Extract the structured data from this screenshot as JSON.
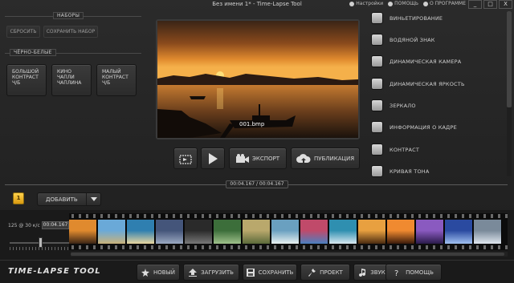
{
  "window": {
    "title": "Без имени 1* - Time-Lapse Tool",
    "links": [
      "Настройки",
      "ПОМОЩЬ",
      "О ПРОГРАММЕ"
    ],
    "buttons": [
      "_",
      "□",
      "X"
    ]
  },
  "presets_panel": {
    "section_label": "НАБОРЫ",
    "reset_label": "СБРОСИТЬ",
    "save_label": "СОХРАНИТЬ НАБОР",
    "bw_section_label": "ЧЁРНО-БЕЛЫЕ",
    "presets": [
      {
        "line1": "БОЛЬШОЙ",
        "line2": "КОНТРАСТ",
        "line3": "Ч/Б"
      },
      {
        "line1": "КИНО",
        "line2": "ЧАПЛИ",
        "line3": "ЧАПЛИНА"
      },
      {
        "line1": "МАЛЫЙ",
        "line2": "КОНТРАСТ",
        "line3": "Ч/Б"
      }
    ]
  },
  "preview": {
    "filename": "001.bmp"
  },
  "player": {
    "export_label": "ЭКСПОРТ",
    "publish_label": "ПУБЛИКАЦИЯ"
  },
  "effects": [
    "ВИНЬЕТИРОВАНИЕ",
    "ВОДЯНОЙ ЗНАК",
    "ДИНАМИЧЕСКАЯ КАМЕРА",
    "ДИНАМИЧЕСКАЯ ЯРКОСТЬ",
    "ЗЕРКАЛО",
    "ИНФОРМАЦИЯ О КАДРЕ",
    "КОНТРАСТ",
    "КРИВАЯ ТОНА"
  ],
  "time": {
    "display": "00:04.167 / 00:04.167"
  },
  "timeline": {
    "track_number": "1",
    "add_label": "ДОБАВИТЬ",
    "fps_label": "125 @ 30 к/с",
    "duration": "00:04.167",
    "zoom_level": 0.52
  },
  "footer": {
    "brand": "TIME-LAPSE TOOL",
    "buttons": [
      "НОВЫЙ",
      "ЗАГРУЗИТЬ",
      "СОХРАНИТЬ",
      "ПРОЕКТ",
      "ЗВУК",
      "ПОМОЩЬ"
    ]
  },
  "colors": {
    "accent_badge": "#f0b422",
    "background": "#262626",
    "effect_checkbox": "#bdbdbd"
  }
}
